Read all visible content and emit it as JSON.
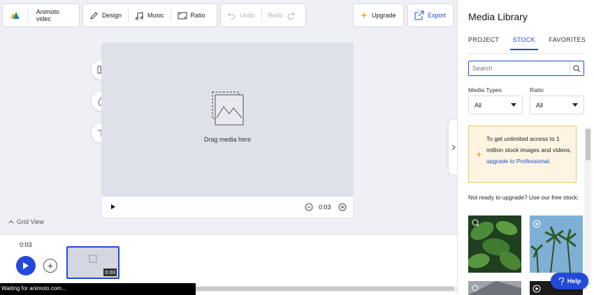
{
  "toolbar": {
    "project_name": "Animoto videc",
    "design_label": "Design",
    "music_label": "Music",
    "ratio_label": "Ratio",
    "undo_label": "Undo",
    "redo_label": "Redo",
    "upgrade_label": "Upgrade",
    "export_label": "Export"
  },
  "canvas": {
    "drop_label": "Drag media here",
    "time": "0:03"
  },
  "grid_view_label": "Grid View",
  "timeline": {
    "current_time": "0:03",
    "clip_duration": "0:03"
  },
  "status_text": "Waiting for animoto.com...",
  "panel": {
    "title": "Media Library",
    "tabs": [
      {
        "label": "PROJECT"
      },
      {
        "label": "STOCK"
      },
      {
        "label": "FAVORITES"
      }
    ],
    "search_placeholder": "Search",
    "media_types_label": "Media Types",
    "media_types_value": "All",
    "ratio_label": "Ratio",
    "ratio_value": "All",
    "banner": {
      "text": "To get unlimited access to 1 million stock images and videos,",
      "link": "upgrade to Professional",
      "suffix": "."
    },
    "free_stock_text": "Not ready to upgrade? Use our free stock:"
  },
  "help_label": "Help",
  "colors": {
    "accent": "#2349d8",
    "banner_bg": "#fdf5e2",
    "banner_border": "#f1c56b",
    "canvas_bg": "#dfe1ea",
    "app_bg": "#eef0f6"
  }
}
